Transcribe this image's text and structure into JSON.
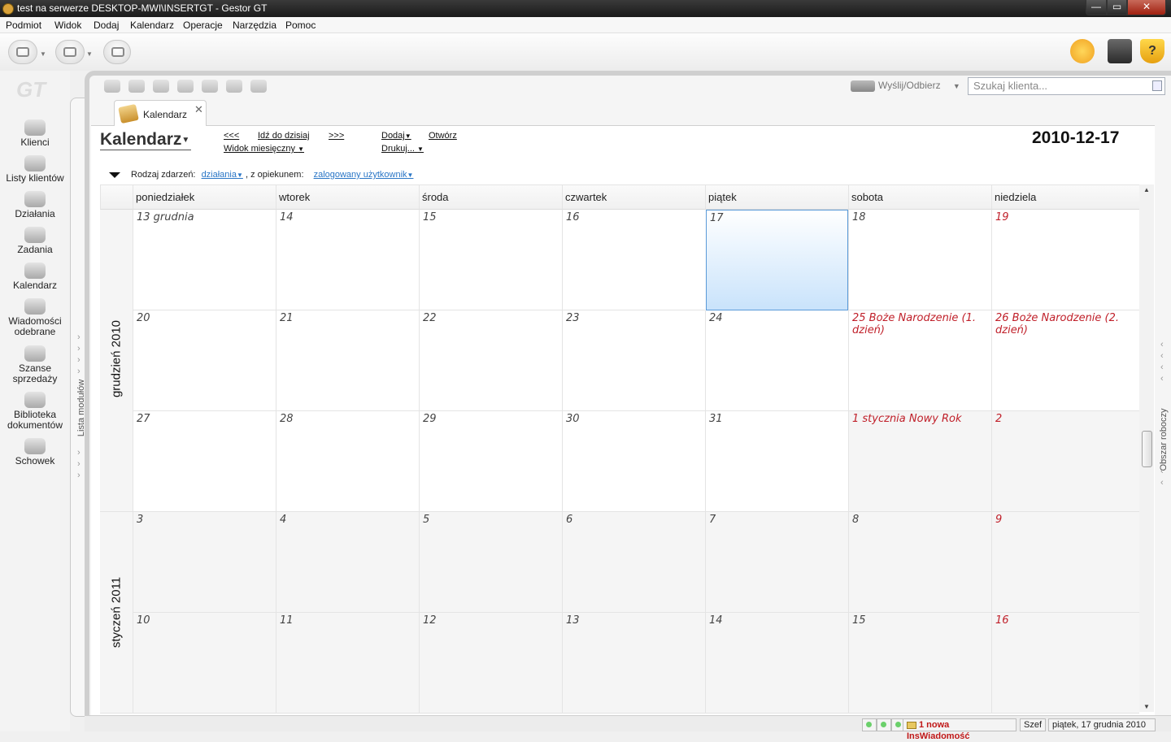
{
  "window": {
    "title": "test na serwerze DESKTOP-MWI\\INSERTGT - Gestor GT",
    "min": "—",
    "max": "▭",
    "close": "✕"
  },
  "menu": [
    "Podmiot",
    "Widok",
    "Dodaj",
    "Kalendarz",
    "Operacje",
    "Narzędzia",
    "Pomoc"
  ],
  "sidebar": {
    "logo": "GT",
    "items": [
      {
        "label": "Klienci"
      },
      {
        "label": "Listy klientów"
      },
      {
        "label": "Działania"
      },
      {
        "label": "Zadania"
      },
      {
        "label": "Kalendarz"
      },
      {
        "label": "Wiadomości odebrane"
      },
      {
        "label": "Szanse sprzedaży"
      },
      {
        "label": "Biblioteka dokumentów"
      },
      {
        "label": "Schowek"
      }
    ],
    "module_tab": "Lista modułów"
  },
  "worktab": "Obszar roboczy",
  "send": {
    "label": "Wyślij/Odbierz"
  },
  "search": {
    "placeholder": "Szukaj klienta..."
  },
  "tab": {
    "label": "Kalendarz",
    "close": "✕"
  },
  "calendar": {
    "title": "Kalendarz",
    "prev": "<<<",
    "today": "Idź do dzisiaj",
    "next": ">>>",
    "view": "Widok miesięczny",
    "add": "Dodaj",
    "open": "Otwórz",
    "print": "Drukuj...",
    "current_date": "2010-12-17",
    "filter_label": "Rodzaj zdarzeń:",
    "filter_value": "działania",
    "caretaker_label": ", z opiekunem:",
    "caretaker_value": "zalogowany użytkownik",
    "weekdays": [
      "poniedziałek",
      "wtorek",
      "środa",
      "czwartek",
      "piątek",
      "sobota",
      "niedziela"
    ],
    "months": [
      "grudzień 2010",
      "styczeń 2011"
    ],
    "weeks": [
      [
        "13 grudnia",
        "14",
        "15",
        "16",
        "17",
        "18",
        "19"
      ],
      [
        "20",
        "21",
        "22",
        "23",
        "24",
        "25 Boże Narodzenie (1. dzień)",
        "26 Boże Narodzenie (2. dzień)"
      ],
      [
        "27",
        "28",
        "29",
        "30",
        "31",
        "1 stycznia Nowy Rok",
        "2"
      ],
      [
        "3",
        "4",
        "5",
        "6",
        "7",
        "8",
        "9"
      ],
      [
        "10",
        "11",
        "12",
        "13",
        "14",
        "15",
        "16"
      ]
    ]
  },
  "status": {
    "notification": "1 nowa InsWiadomość",
    "user": "Szef",
    "date": "piątek, 17 grudnia 2010"
  }
}
